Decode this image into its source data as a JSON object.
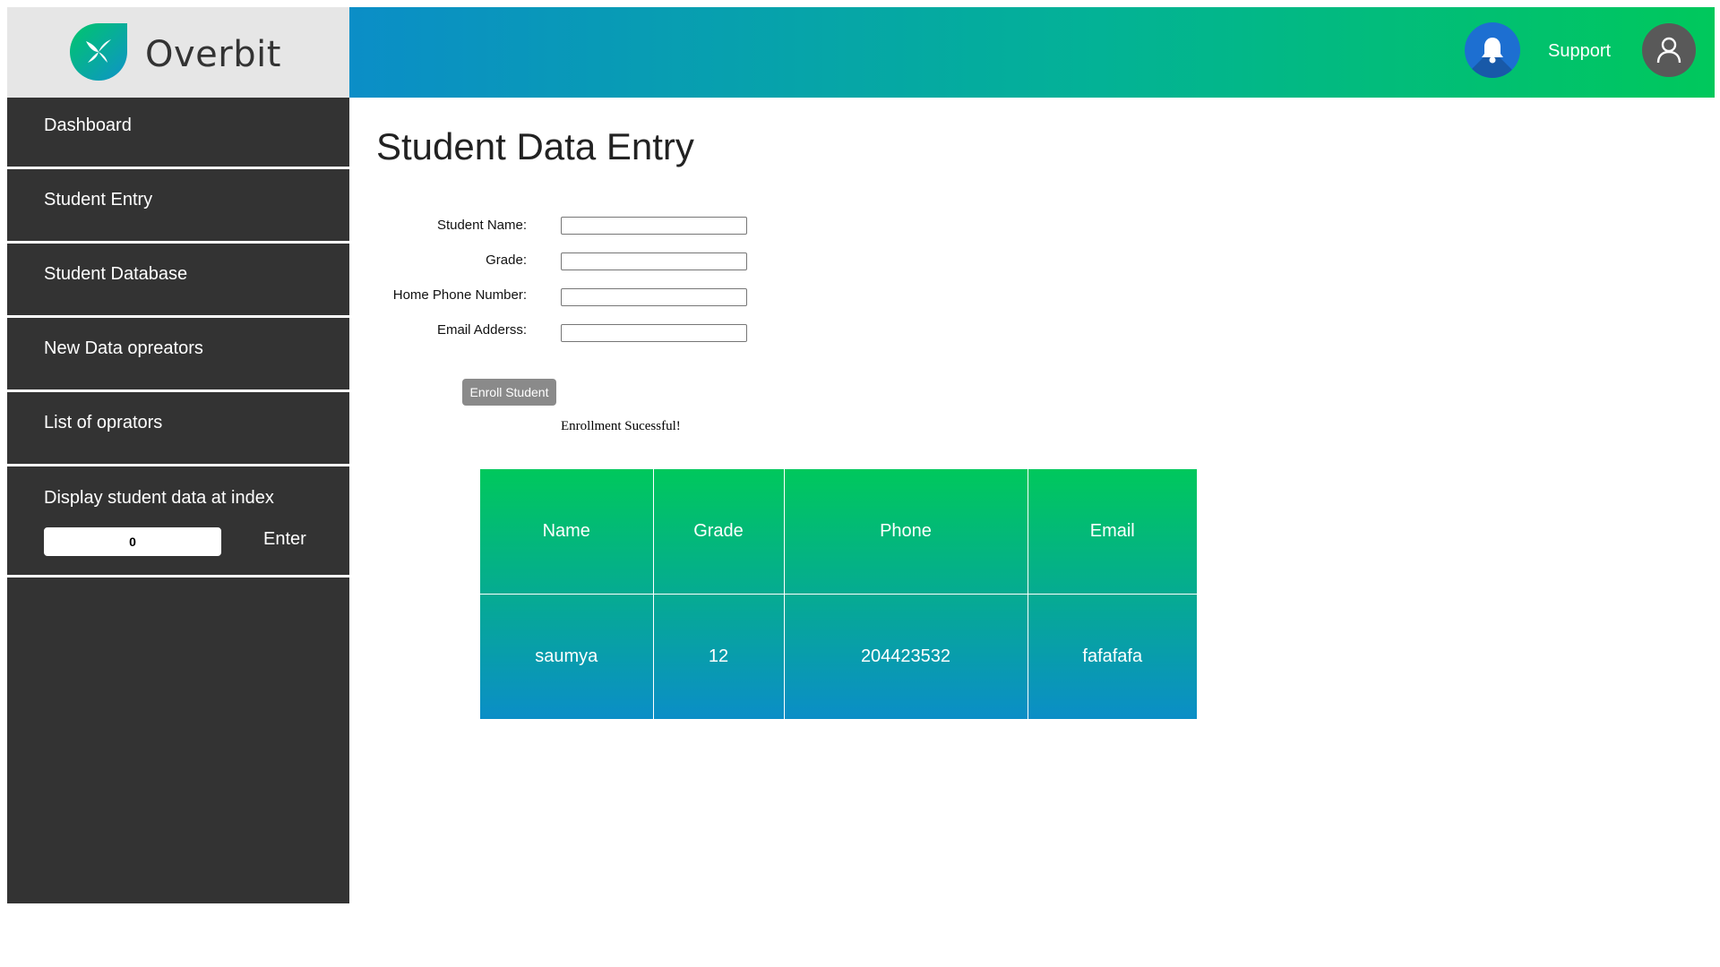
{
  "brand": {
    "name": "Overbit",
    "logo_icon": "butterfly-logo-icon",
    "logo_colors": [
      "#00c66b",
      "#0f93c9"
    ]
  },
  "header": {
    "gradient": [
      "#0b8ec7",
      "#00c85c"
    ],
    "notification_icon": "bell-icon",
    "support_label": "Support",
    "user_icon": "user-icon"
  },
  "sidebar": {
    "items": [
      {
        "label": "Dashboard"
      },
      {
        "label": "Student Entry"
      },
      {
        "label": "Student Database"
      },
      {
        "label": "New Data opreators"
      },
      {
        "label": "List of oprators"
      }
    ],
    "index_panel": {
      "label": "Display student data at index",
      "value": "0",
      "enter_label": "Enter"
    }
  },
  "main": {
    "title": "Student Data Entry",
    "form": {
      "fields": [
        {
          "label": "Student Name:",
          "value": ""
        },
        {
          "label": "Grade:",
          "value": ""
        },
        {
          "label": "Home Phone Number:",
          "value": ""
        },
        {
          "label": "Email Adderss:",
          "value": ""
        }
      ],
      "submit_label": "Enroll Student",
      "status_message": "Enrollment Sucessful!"
    },
    "table": {
      "headers": [
        "Name",
        "Grade",
        "Phone",
        "Email"
      ],
      "rows": [
        [
          "saumya",
          "12",
          "204423532",
          "fafafafa"
        ]
      ]
    }
  }
}
